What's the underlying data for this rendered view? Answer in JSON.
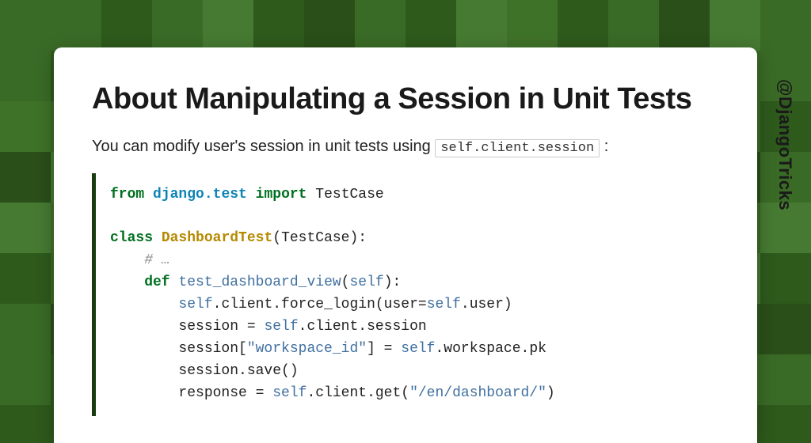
{
  "handle": "@DjangoTricks",
  "title": "About Manipulating a Session in Unit Tests",
  "intro_prefix": "You can modify user's session in unit tests using ",
  "intro_code": "self.client.session",
  "intro_suffix": " :",
  "code": {
    "l1_from": "from",
    "l1_mod": "django.test",
    "l1_import": "import",
    "l1_name": " TestCase",
    "l3_class": "class",
    "l3_name": "DashboardTest",
    "l3_tail": "(TestCase):",
    "l4_comment": "    # …",
    "l5_def": "    def",
    "l5_fn": "test_dashboard_view",
    "l5_open": "(",
    "l5_self": "self",
    "l5_close": "):",
    "l6_indent": "        ",
    "l6_self": "self",
    "l6_tail": ".client.force_login(user=",
    "l6_self2": "self",
    "l6_tail2": ".user)",
    "l7_indent": "        session = ",
    "l7_self": "self",
    "l7_tail": ".client.session",
    "l8_indent": "        session[",
    "l8_str": "\"workspace_id\"",
    "l8_mid": "] = ",
    "l8_self": "self",
    "l8_tail": ".workspace.pk",
    "l9": "        session.save()",
    "l10_indent": "        response = ",
    "l10_self": "self",
    "l10_mid": ".client.get(",
    "l10_str": "\"/en/dashboard/\"",
    "l10_tail": ")"
  }
}
